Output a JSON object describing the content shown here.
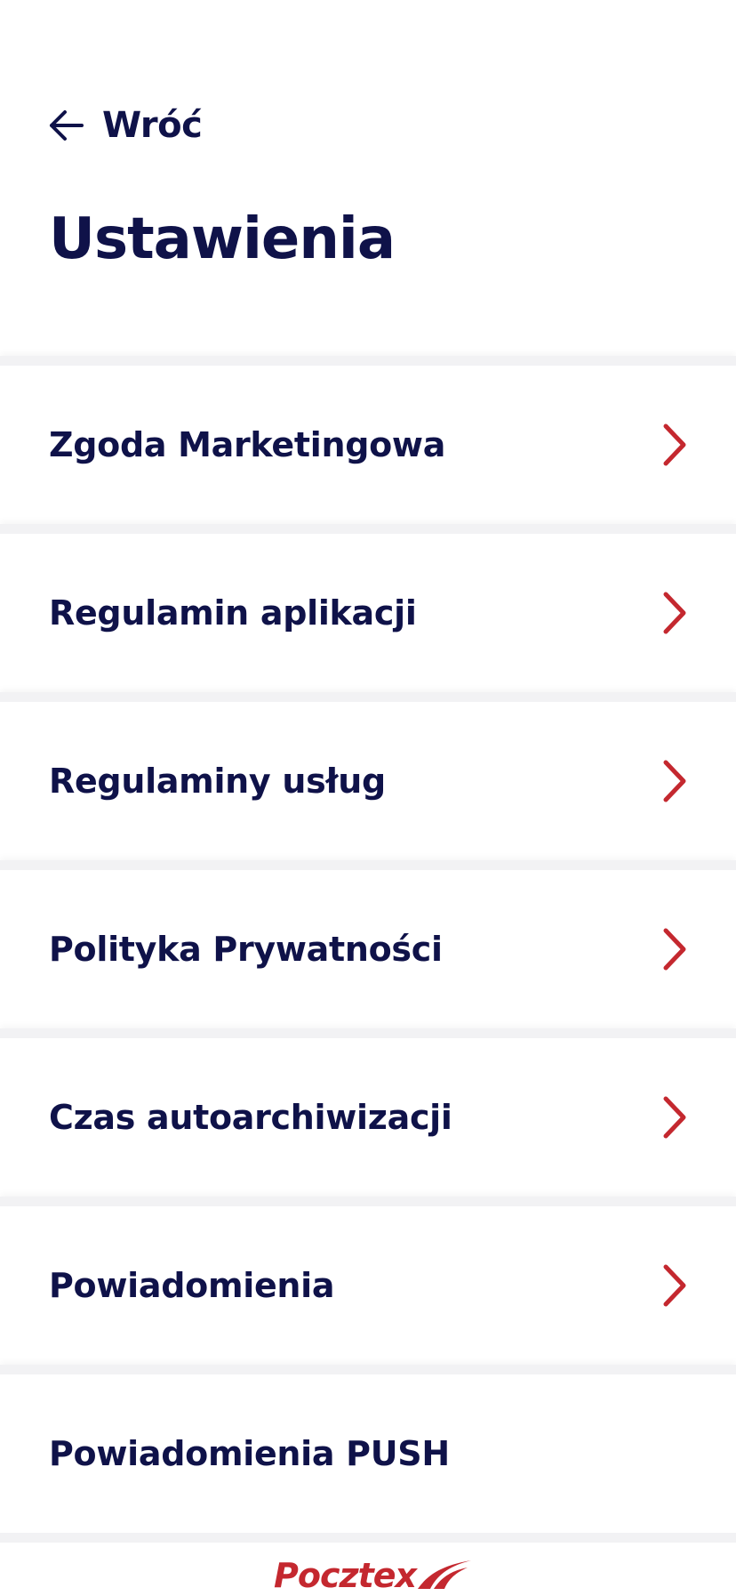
{
  "header": {
    "back_label": "Wróć",
    "title": "Ustawienia"
  },
  "menu": {
    "items": [
      {
        "label": "Zgoda Marketingowa",
        "chevron": true
      },
      {
        "label": "Regulamin aplikacji",
        "chevron": true
      },
      {
        "label": "Regulaminy usług",
        "chevron": true
      },
      {
        "label": "Polityka Prywatności",
        "chevron": true
      },
      {
        "label": "Czas autoarchiwizacji",
        "chevron": true
      },
      {
        "label": "Powiadomienia",
        "chevron": true
      },
      {
        "label": "Powiadomienia PUSH",
        "chevron": false
      }
    ]
  },
  "footer": {
    "logo_text": "Pocztex"
  },
  "colors": {
    "text": "#0f1249",
    "accent": "#c4282f",
    "divider": "#f2f2f4",
    "background": "#ffffff"
  },
  "icons": {
    "back": "arrow-left-icon",
    "chevron": "chevron-right-icon",
    "logo": "pocztex-wing-icon"
  }
}
